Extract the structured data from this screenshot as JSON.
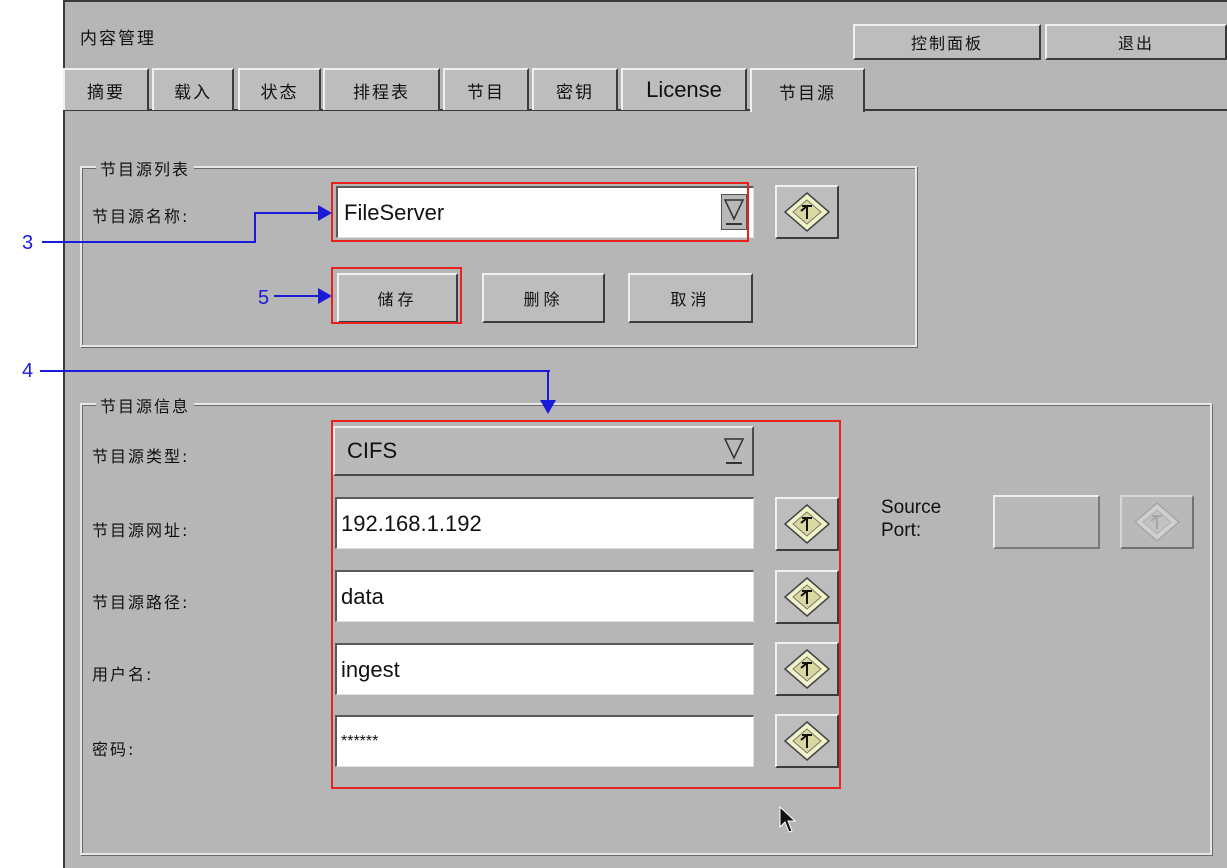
{
  "header": {
    "title": "内容管理",
    "control_panel": "控制面板",
    "exit": "退出"
  },
  "tabs": [
    {
      "label": "摘要"
    },
    {
      "label": "载入"
    },
    {
      "label": "状态"
    },
    {
      "label": "排程表"
    },
    {
      "label": "节目"
    },
    {
      "label": "密钥"
    },
    {
      "label": "License"
    },
    {
      "label": "节目源",
      "active": true
    }
  ],
  "source_list": {
    "legend": "节目源列表",
    "name_label": "节目源名称:",
    "name_value": "FileServer",
    "save": "储存",
    "delete": "删除",
    "cancel": "取消"
  },
  "source_info": {
    "legend": "节目源信息",
    "type_label": "节目源类型:",
    "type_value": "CIFS",
    "url_label": "节目源网址:",
    "url_value": "192.168.1.192",
    "path_label": "节目源路径:",
    "path_value": "data",
    "user_label": "用户名:",
    "user_value": "ingest",
    "password_label": "密码:",
    "password_value": "******",
    "port_label_1": "Source",
    "port_label_2": "Port:",
    "port_value": ""
  },
  "callouts": {
    "c3": "3",
    "c4": "4",
    "c5": "5"
  },
  "colors": {
    "panel": "#b6b6b6",
    "highlight_box": "#e8231f",
    "callout": "#1a1ad8"
  },
  "icons": {
    "keyboard_button": "edit-keyboard-icon",
    "dropdown": "dropdown-arrow-icon",
    "cursor": "mouse-pointer-icon"
  }
}
